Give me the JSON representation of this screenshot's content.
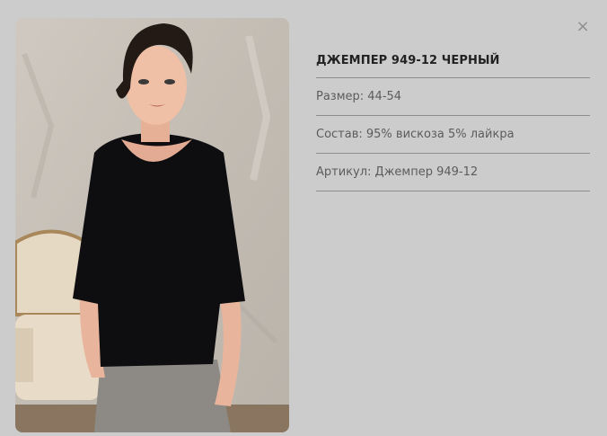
{
  "product": {
    "title": "ДЖЕМПЕР 949-12 ЧЕРНЫЙ",
    "size": "Размер: 44-54",
    "composition": "Состав: 95% вискоза 5% лайкра",
    "article": "Артикул: Джемпер 949-12"
  },
  "modal": {
    "close_symbol": "×",
    "close_icon": "close-icon",
    "image_icon": "product-photo"
  },
  "colors": {
    "background": "#cccccc",
    "divider": "#8e8e8e",
    "title": "#222222",
    "text": "#5c5c5c",
    "close": "#8f8f8f"
  }
}
